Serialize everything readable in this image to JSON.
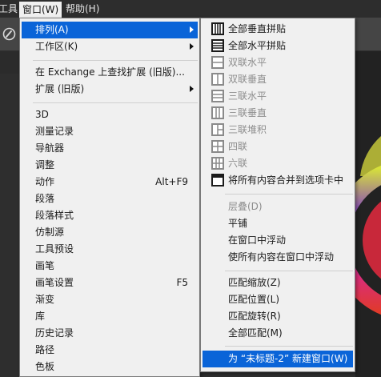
{
  "menubar": {
    "items": [
      {
        "label": "工具"
      },
      {
        "label": "窗口(W)"
      },
      {
        "label": "帮助(H)"
      }
    ]
  },
  "colors": {
    "menu_bg": "#f0f0f0",
    "highlight": "#0a64d8",
    "disabled_text": "#8d8d8d",
    "menubar_bg": "#2d2d2d",
    "options_bar_bg": "#454545"
  },
  "window_menu": {
    "items": [
      {
        "label": "排列(A)",
        "submenu": true,
        "highlighted": true
      },
      {
        "label": "工作区(K)",
        "submenu": true
      },
      {
        "label": "在 Exchange 上查找扩展 (旧版)..."
      },
      {
        "label": "扩展 (旧版)",
        "submenu": true
      },
      {
        "label": "3D"
      },
      {
        "label": "测量记录"
      },
      {
        "label": "导航器"
      },
      {
        "label": "调整"
      },
      {
        "label": "动作",
        "shortcut": "Alt+F9"
      },
      {
        "label": "段落"
      },
      {
        "label": "段落样式"
      },
      {
        "label": "仿制源"
      },
      {
        "label": "工具预设"
      },
      {
        "label": "画笔"
      },
      {
        "label": "画笔设置",
        "shortcut": "F5"
      },
      {
        "label": "渐变"
      },
      {
        "label": "库"
      },
      {
        "label": "历史记录"
      },
      {
        "label": "路径"
      },
      {
        "label": "色板"
      }
    ]
  },
  "arrange_submenu": {
    "items": [
      {
        "label": "全部垂直拼贴",
        "icon": "tile-all-vertical-icon"
      },
      {
        "label": "全部水平拼贴",
        "icon": "tile-all-horizontal-icon"
      },
      {
        "label": "双联水平",
        "icon": "two-up-horizontal-icon",
        "disabled": true
      },
      {
        "label": "双联垂直",
        "icon": "two-up-vertical-icon",
        "disabled": true
      },
      {
        "label": "三联水平",
        "icon": "three-up-horizontal-icon",
        "disabled": true
      },
      {
        "label": "三联垂直",
        "icon": "three-up-vertical-icon",
        "disabled": true
      },
      {
        "label": "三联堆积",
        "icon": "three-up-stacked-icon",
        "disabled": true
      },
      {
        "label": "四联",
        "icon": "four-up-icon",
        "disabled": true
      },
      {
        "label": "六联",
        "icon": "six-up-icon",
        "disabled": true
      },
      {
        "label": "将所有内容合并到选项卡中",
        "icon": "consolidate-tabs-icon"
      },
      {
        "label": "层叠(D)",
        "disabled": true
      },
      {
        "label": "平铺"
      },
      {
        "label": "在窗口中浮动"
      },
      {
        "label": "使所有内容在窗口中浮动"
      },
      {
        "label": "匹配缩放(Z)"
      },
      {
        "label": "匹配位置(L)"
      },
      {
        "label": "匹配旋转(R)"
      },
      {
        "label": "全部匹配(M)"
      },
      {
        "label": "为 “未标题-2” 新建窗口(W)",
        "highlighted": true
      }
    ]
  }
}
